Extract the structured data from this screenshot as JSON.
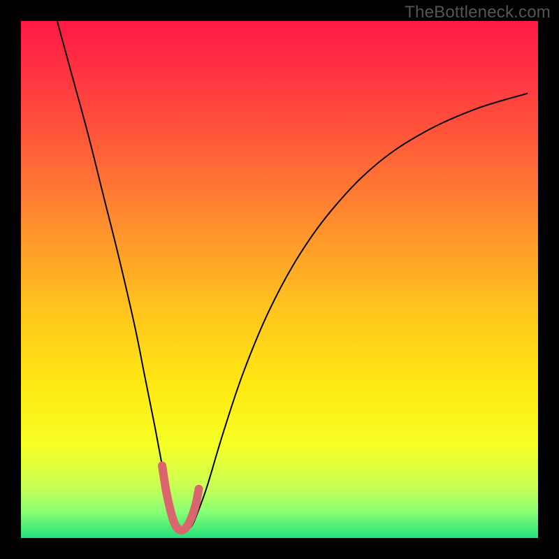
{
  "watermark": "TheBottleneck.com",
  "gradient": {
    "stops": [
      {
        "pct": 0,
        "color": "#ff1846"
      },
      {
        "pct": 18,
        "color": "#ff4a3d"
      },
      {
        "pct": 38,
        "color": "#ff8a2f"
      },
      {
        "pct": 55,
        "color": "#ffc21e"
      },
      {
        "pct": 70,
        "color": "#ffe812"
      },
      {
        "pct": 82,
        "color": "#f6ff24"
      },
      {
        "pct": 90,
        "color": "#c9ff55"
      },
      {
        "pct": 95,
        "color": "#88ff74"
      },
      {
        "pct": 100,
        "color": "#22e07a"
      }
    ]
  },
  "chart_data": {
    "type": "line",
    "title": "",
    "xlabel": "",
    "ylabel": "",
    "xlim": [
      0,
      100
    ],
    "ylim": [
      0,
      100
    ],
    "grid": false,
    "legend": "none",
    "series": [
      {
        "name": "bottleneck-curve",
        "color": "#000000",
        "width": 2,
        "x": [
          7,
          10,
          13,
          16,
          19,
          22,
          24,
          26,
          27.5,
          29,
          30,
          31,
          32,
          33,
          34,
          36,
          39,
          43,
          48,
          54,
          61,
          69,
          78,
          88,
          98
        ],
        "y": [
          100,
          89,
          78,
          66,
          54,
          41,
          31,
          21,
          13,
          5.5,
          2.3,
          1.6,
          1.6,
          2.3,
          4.5,
          10,
          20,
          32,
          44,
          55,
          64.5,
          72.5,
          78.5,
          83,
          86
        ]
      },
      {
        "name": "trough-highlight",
        "color": "#d9666d",
        "width": 12,
        "linecap": "round",
        "x": [
          27.3,
          28.1,
          29.0,
          29.8,
          30.6,
          31.4,
          32.2,
          33.0,
          33.8,
          34.4
        ],
        "y": [
          14.0,
          9.0,
          5.0,
          2.6,
          1.6,
          1.6,
          2.4,
          4.0,
          6.5,
          9.5
        ]
      }
    ]
  }
}
